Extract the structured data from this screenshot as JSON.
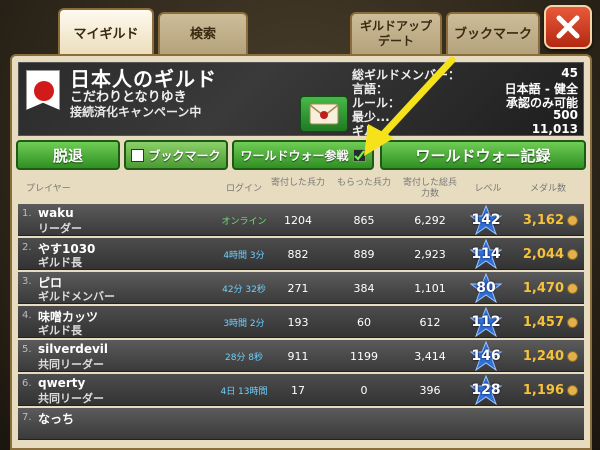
{
  "tabs": {
    "my_guild": "マイギルド",
    "search": "検索",
    "guild_update": "ギルドアップ\nデート",
    "bookmark": "ブックマーク"
  },
  "guild": {
    "name": "日本人のギルド",
    "subtitle": "こだわりとなりゆき",
    "campaign": "接続済化キャンペーン中",
    "stats": [
      {
        "label": "総ギルドメンバー：",
        "value": "45"
      },
      {
        "label": "言語：",
        "value": "日本語 - 健全"
      },
      {
        "label": "ルール：",
        "value": "承認のみ可能"
      },
      {
        "label": "最少...",
        "value": "500"
      },
      {
        "label": "ギル...",
        "value": "11,013"
      }
    ]
  },
  "actions": {
    "leave": "脱退",
    "bookmark": "ブックマーク",
    "war_join": "ワールドウォー参戦",
    "war_record": "ワールドウォー記録"
  },
  "columns": {
    "player": "プレイヤー",
    "login": "ログイン",
    "sent_troops": "寄付した兵力",
    "received_troops": "もらった兵力",
    "donated_total": "寄付した総兵力数",
    "level": "レベル",
    "medals": "メダル数"
  },
  "members": [
    {
      "rank": "1.",
      "name": "waku",
      "role": "リーダー",
      "login": "オンライン",
      "online": true,
      "sent": "1204",
      "received": "865",
      "donated": "6,292",
      "level": "142",
      "medals": "3,162"
    },
    {
      "rank": "2.",
      "name": "やす1030",
      "role": "ギルド長",
      "login": "4時間 3分",
      "online": false,
      "sent": "882",
      "received": "889",
      "donated": "2,923",
      "level": "114",
      "medals": "2,044"
    },
    {
      "rank": "3.",
      "name": "ピロ",
      "role": "ギルドメンバー",
      "login": "42分 32秒",
      "online": false,
      "sent": "271",
      "received": "384",
      "donated": "1,101",
      "level": "80",
      "medals": "1,470"
    },
    {
      "rank": "4.",
      "name": "味噌カッツ",
      "role": "ギルド長",
      "login": "3時間 2分",
      "online": false,
      "sent": "193",
      "received": "60",
      "donated": "612",
      "level": "112",
      "medals": "1,457"
    },
    {
      "rank": "5.",
      "name": "silverdevil",
      "role": "共同リーダー",
      "login": "28分 8秒",
      "online": false,
      "sent": "911",
      "received": "1199",
      "donated": "3,414",
      "level": "146",
      "medals": "1,240"
    },
    {
      "rank": "6.",
      "name": "qwerty",
      "role": "共同リーダー",
      "login": "4日 13時間",
      "online": false,
      "sent": "17",
      "received": "0",
      "donated": "396",
      "level": "128",
      "medals": "1,196"
    },
    {
      "rank": "7.",
      "name": "なっち",
      "role": "",
      "login": "",
      "online": false,
      "sent": "",
      "received": "",
      "donated": "",
      "level": "",
      "medals": ""
    }
  ],
  "colors": {
    "green_button": "#3fa82e",
    "star_blue": "#2f6fd6",
    "arrow_yellow": "#f5e21a",
    "close_red": "#d4401f"
  }
}
